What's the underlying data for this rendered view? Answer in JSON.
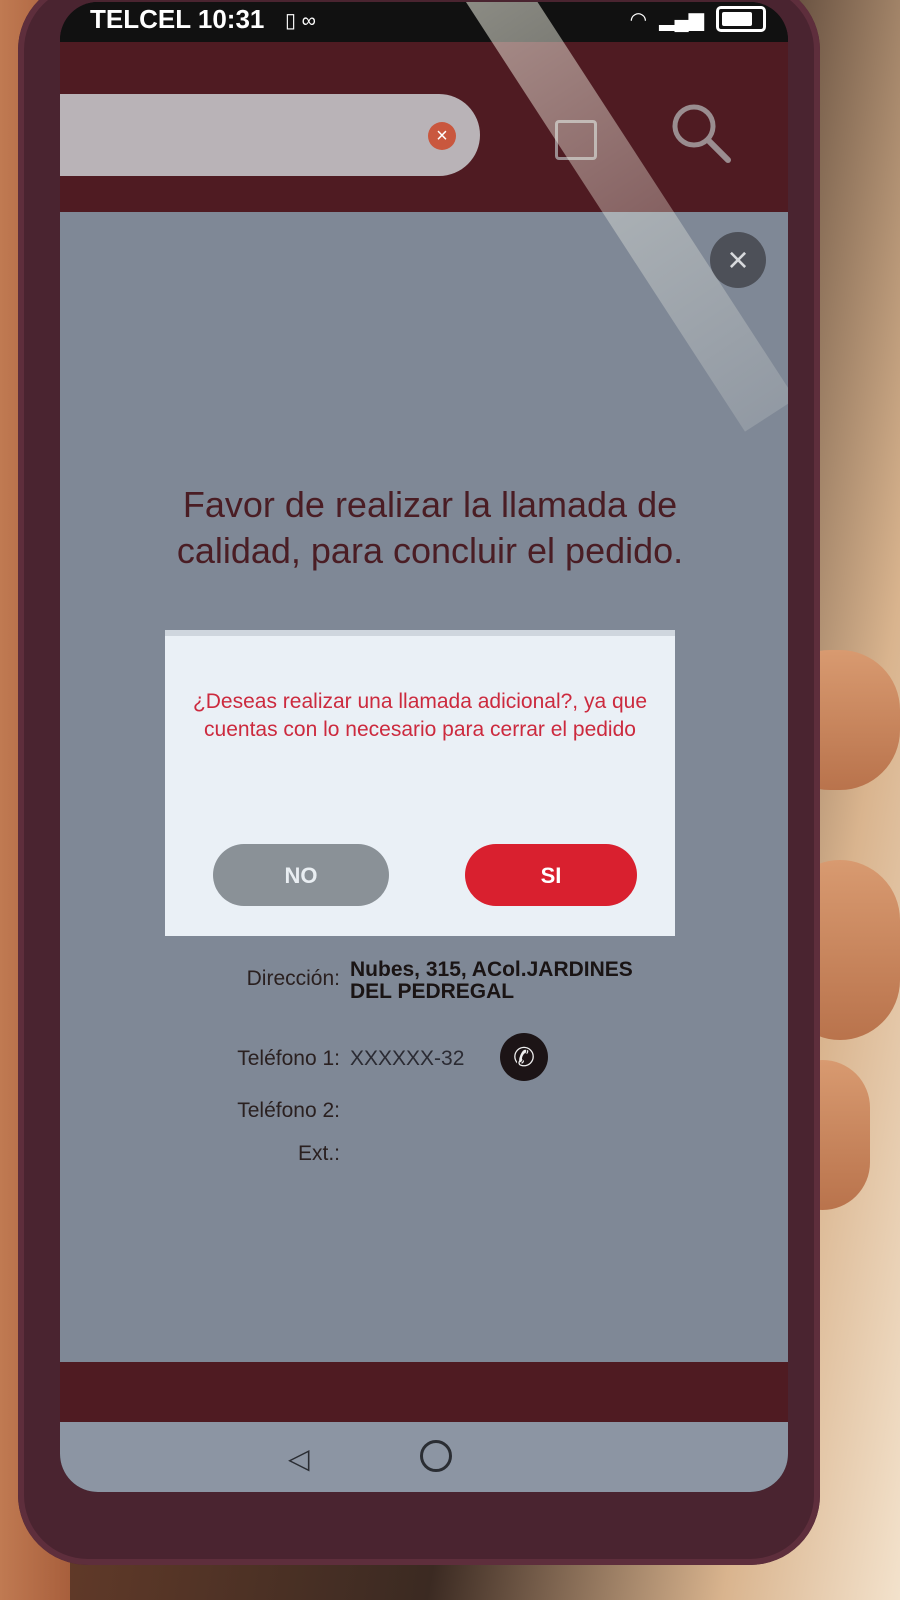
{
  "status_bar": {
    "carrier": "TELCEL",
    "time": "10:31"
  },
  "overlay": {
    "instruction": "Favor de realizar la llamada de calidad, para concluir el pedido."
  },
  "dialog": {
    "message": "¿Deseas realizar una llamada adicional?, ya que cuentas con lo necesario para cerrar el pedido",
    "no_label": "NO",
    "si_label": "SI"
  },
  "details": {
    "direccion_label": "Dirección:",
    "direccion_value": "Nubes, 315, ACol.JARDINES DEL PEDREGAL",
    "telefono1_label": "Teléfono 1:",
    "telefono1_value": "XXXXXX-32",
    "telefono2_label": "Teléfono 2:",
    "ext_label": "Ext.:"
  },
  "colors": {
    "brand": "#4f1b22",
    "accent": "#d9202f",
    "dialog_text": "#cc2a3e"
  }
}
